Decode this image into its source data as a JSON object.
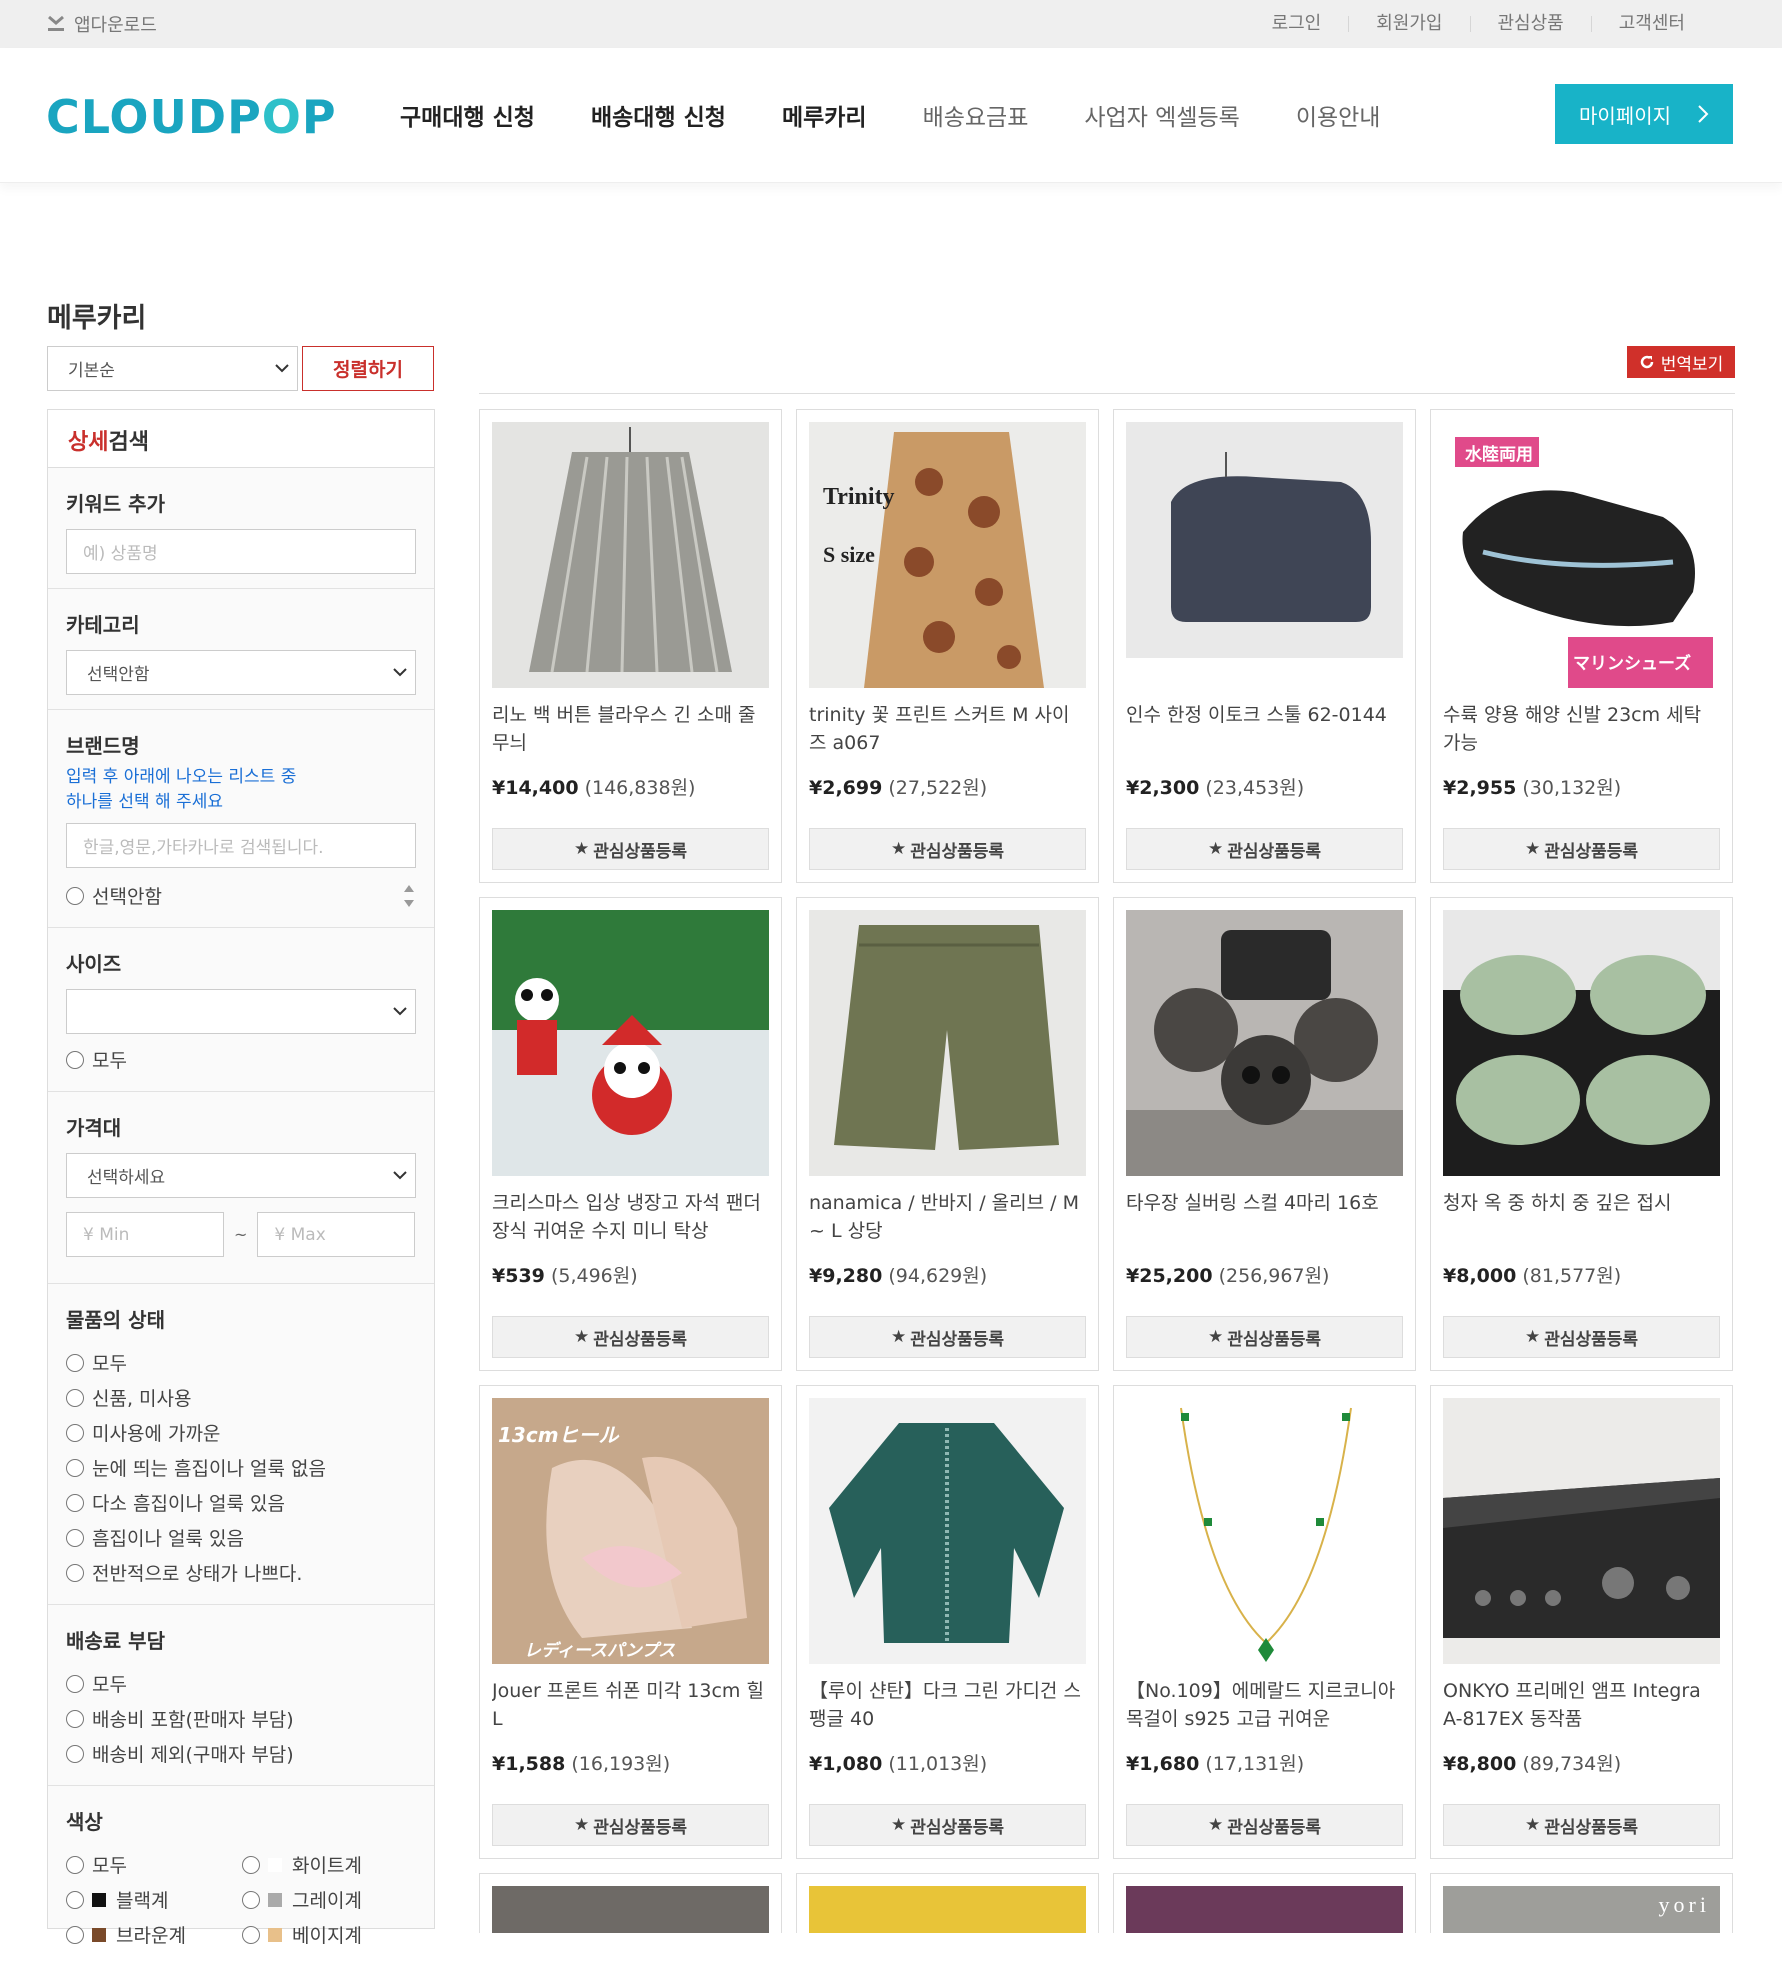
{
  "topbar": {
    "app_download": "앱다운로드",
    "links": [
      "로그인",
      "회원가입",
      "관심상품",
      "고객센터"
    ]
  },
  "header": {
    "logo": {
      "part1": "CLOUDP",
      "part2": "O",
      "part3": "P"
    },
    "nav": [
      {
        "label": "구매대행 신청"
      },
      {
        "label": "배송대행 신청"
      },
      {
        "label": "메루카리"
      },
      {
        "label": "배송요금표"
      },
      {
        "label": "사업자 엑셀등록"
      },
      {
        "label": "이용안내"
      }
    ],
    "mypage": "마이페이지"
  },
  "page": {
    "title": "메루카리",
    "sort_value": "기본순",
    "sort_button": "정렬하기",
    "translate_button": "번역보기"
  },
  "sidebar": {
    "head_red": "상세",
    "head_rest": "검색",
    "keyword": {
      "label": "키워드 추가",
      "placeholder": "예) 상품명"
    },
    "category": {
      "label": "카테고리",
      "value": "선택안함"
    },
    "brand": {
      "label": "브랜드명",
      "hint1": "입력 후 아래에 나오는 리스트 중",
      "hint2": "하나를 선택 해 주세요",
      "placeholder": "한글,영문,가타카나로 검색됩니다.",
      "option": "선택안함"
    },
    "size": {
      "label": "사이즈",
      "value": "",
      "option": "모두"
    },
    "price": {
      "label": "가격대",
      "value": "선택하세요",
      "min": "¥ Min",
      "max": "¥ Max",
      "sep": "~"
    },
    "condition": {
      "label": "물품의 상태",
      "options": [
        "모두",
        "신품, 미사용",
        "미사용에 가까운",
        "눈에 띄는 흠집이나 얼룩 없음",
        "다소 흠집이나 얼룩 있음",
        "흠집이나 얼룩 있음",
        "전반적으로 상태가 나쁘다."
      ]
    },
    "shipping": {
      "label": "배송료 부담",
      "options": [
        "모두",
        "배송비 포함(판매자 부담)",
        "배송비 제외(구매자 부담)"
      ]
    },
    "color": {
      "label": "색상",
      "options": [
        {
          "label": "모두",
          "swatch": ""
        },
        {
          "label": "화이트계",
          "swatch": "#ffffff"
        },
        {
          "label": "블랙계",
          "swatch": "#111111"
        },
        {
          "label": "그레이계",
          "swatch": "#aaaaaa"
        },
        {
          "label": "브라운계",
          "swatch": "#7a4a2a"
        },
        {
          "label": "베이지계",
          "swatch": "#e8c08a"
        }
      ]
    }
  },
  "fav_label": "관심상품등록",
  "products": [
    {
      "title": "리노 백 버튼 블라우스 긴 소매 줄무늬",
      "yen": "¥14,400",
      "won": "(146,838원)",
      "image": "striped-blouse"
    },
    {
      "title": "trinity 꽃 프린트 스커트 M 사이즈 a067",
      "yen": "¥2,699",
      "won": "(27,522원)",
      "image": "floral-skirt",
      "overlay1": "Trinity",
      "overlay2": "S size"
    },
    {
      "title": "인수 한정 이토크 스툴 62-0144",
      "yen": "¥2,300",
      "won": "(23,453원)",
      "image": "stool"
    },
    {
      "title": "수륙 양용 해양 신발 23cm 세탁 가능",
      "yen": "¥2,955",
      "won": "(30,132원)",
      "image": "water-shoes",
      "overlay1": "水陸両用",
      "overlay2": "マリンシューズ"
    },
    {
      "title": "크리스마스 입상 냉장고 자석 팬더 장식 귀여운 수지 미니 탁상",
      "yen": "¥539",
      "won": "(5,496원)",
      "image": "panda-magnet"
    },
    {
      "title": "nanamica / 반바지 / 올리브 / M ~ L 상당",
      "yen": "¥9,280",
      "won": "(94,629원)",
      "image": "olive-shorts"
    },
    {
      "title": "타우장 실버링 스컬 4마리 16호",
      "yen": "¥25,200",
      "won": "(256,967원)",
      "image": "skull-ring"
    },
    {
      "title": "청자 옥 중 하치 중 깊은 접시",
      "yen": "¥8,000",
      "won": "(81,577원)",
      "image": "celadon-plates"
    },
    {
      "title": "Jouer 프론트 쉬폰 미각 13cm 힐 L",
      "yen": "¥1,588",
      "won": "(16,193원)",
      "image": "heels",
      "overlay1": "13cmヒール",
      "overlay2": "レディースパンプス"
    },
    {
      "title": "【루이 샨탄】다크 그린 가디건 스팽글 40",
      "yen": "¥1,080",
      "won": "(11,013원)",
      "image": "green-cardigan"
    },
    {
      "title": "【No.109】에메랄드 지르코니아 목걸이 s925 고급 귀여운",
      "yen": "¥1,680",
      "won": "(17,131원)",
      "image": "emerald-necklace"
    },
    {
      "title": "ONKYO 프리메인 앰프 Integra A-817EX 동작품",
      "yen": "¥8,800",
      "won": "(89,734원)",
      "image": "amplifier"
    }
  ],
  "partial_overlay": "yori"
}
